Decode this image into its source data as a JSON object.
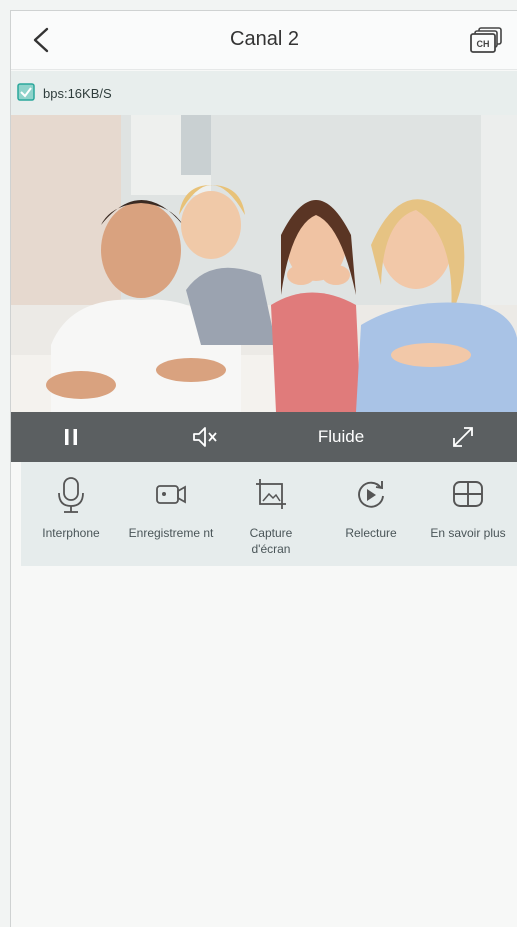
{
  "header": {
    "title": "Canal 2",
    "channel_badge": "CH"
  },
  "status": {
    "bitrate": "bps:16KB/S"
  },
  "video": {
    "description_icon": "live-video"
  },
  "controls": {
    "quality_label": "Fluide"
  },
  "toolbar": {
    "items": [
      {
        "label": "Interphone",
        "icon": "microphone-icon"
      },
      {
        "label": "Enregistreme nt",
        "icon": "record-icon"
      },
      {
        "label": "Capture d'écran",
        "icon": "screenshot-icon"
      },
      {
        "label": "Relecture",
        "icon": "playback-icon"
      },
      {
        "label": "En savoir plus",
        "icon": "more-grid-icon"
      }
    ]
  },
  "colors": {
    "accent": "#2aa79b",
    "control_bar": "#5b5f61",
    "toolbar_bg": "#e6ecec"
  }
}
